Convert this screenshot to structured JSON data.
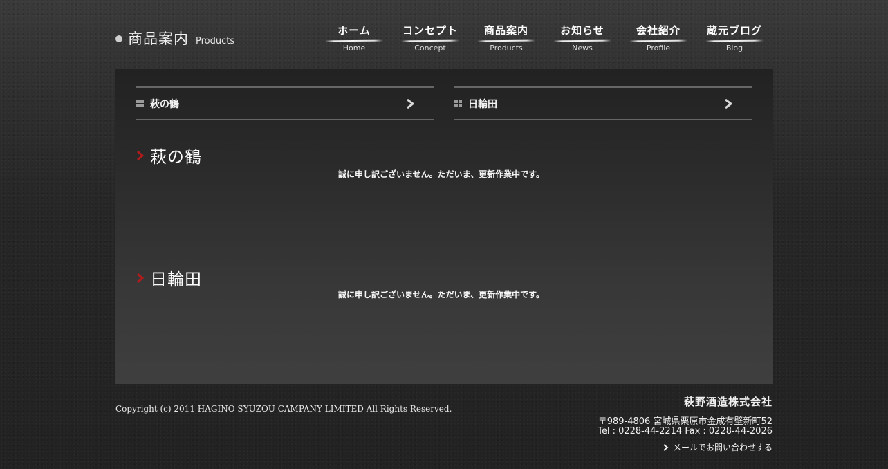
{
  "header": {
    "title_jp": "商品案内",
    "title_en": "Products"
  },
  "nav": [
    {
      "jp": "ホーム",
      "en": "Home"
    },
    {
      "jp": "コンセプト",
      "en": "Concept"
    },
    {
      "jp": "商品案内",
      "en": "Products"
    },
    {
      "jp": "お知らせ",
      "en": "News"
    },
    {
      "jp": "会社紹介",
      "en": "Profile"
    },
    {
      "jp": "蔵元ブログ",
      "en": "Blog"
    }
  ],
  "sub_links": [
    {
      "label": "萩の鶴"
    },
    {
      "label": "日輪田"
    }
  ],
  "sections": [
    {
      "title": "萩の鶴",
      "message": "誠に申し訳ございません。ただいま、更新作業中です。"
    },
    {
      "title": "日輪田",
      "message": "誠に申し訳ございません。ただいま、更新作業中です。"
    }
  ],
  "footer": {
    "copyright": "Copyright (c)  2011 HAGINO SYUZOU CAMPANY LIMITED All Rights Reserved.",
    "company": "萩野酒造株式会社",
    "address": "〒989-4806  宮城県栗原市金成有壁新町52",
    "tel_fax": "Tel : 0228-44-2214    Fax : 0228-44-2026",
    "mail_label": "メールでお問い合わせする"
  },
  "colors": {
    "accent_arrow": "#b01c1c",
    "panel_bg": "#333333"
  }
}
